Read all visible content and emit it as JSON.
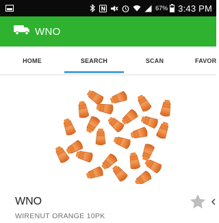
{
  "status_bar": {
    "battery_percent": "67%",
    "time": "3:43 PM",
    "icons": [
      "screenshot-icon",
      "bluetooth-icon",
      "nfc-icon",
      "mute-icon",
      "alarm-icon",
      "wifi-icon",
      "signal-icon",
      "battery-icon"
    ]
  },
  "app_bar": {
    "title": "WNO",
    "icon": "delivery-truck-icon",
    "background": "#2fb22f"
  },
  "tabs": [
    {
      "label": "HOME",
      "active": false
    },
    {
      "label": "SEARCH",
      "active": true
    },
    {
      "label": "SCAN",
      "active": false
    },
    {
      "label": "FAVOR",
      "active": false
    }
  ],
  "accent_color": "#4aa0e0",
  "product": {
    "name": "WNO",
    "description": "WIRENUT ORANGE 10PK",
    "image": "orange-wire-nuts-pile",
    "favorite": false
  }
}
